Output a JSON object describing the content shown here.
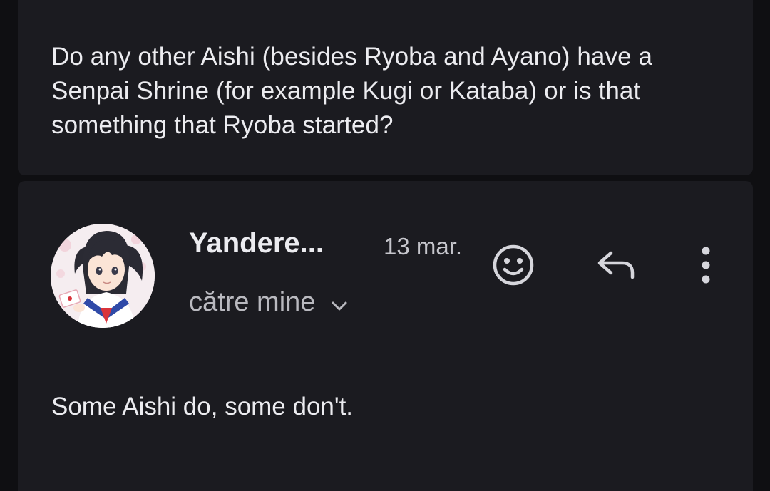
{
  "previous_message": {
    "body": "Do any other Aishi (besides Ryoba and Ayano) have a Senpai Shrine (for example Kugi or Kataba) or is that something that Ryoba started?"
  },
  "message": {
    "sender": "Yandere...",
    "date": "13 mar.",
    "recipient": "către mine",
    "body": "Some Aishi do, some don't."
  },
  "icons": {
    "add_reaction": "smiley-face-icon",
    "reply": "reply-arrow-icon",
    "more": "vertical-dots-icon",
    "expand": "chevron-down-icon"
  },
  "colors": {
    "background": "#0f0f12",
    "card": "#1b1b20",
    "text_primary": "#ececf0",
    "text_secondary": "#b9b9bf"
  }
}
